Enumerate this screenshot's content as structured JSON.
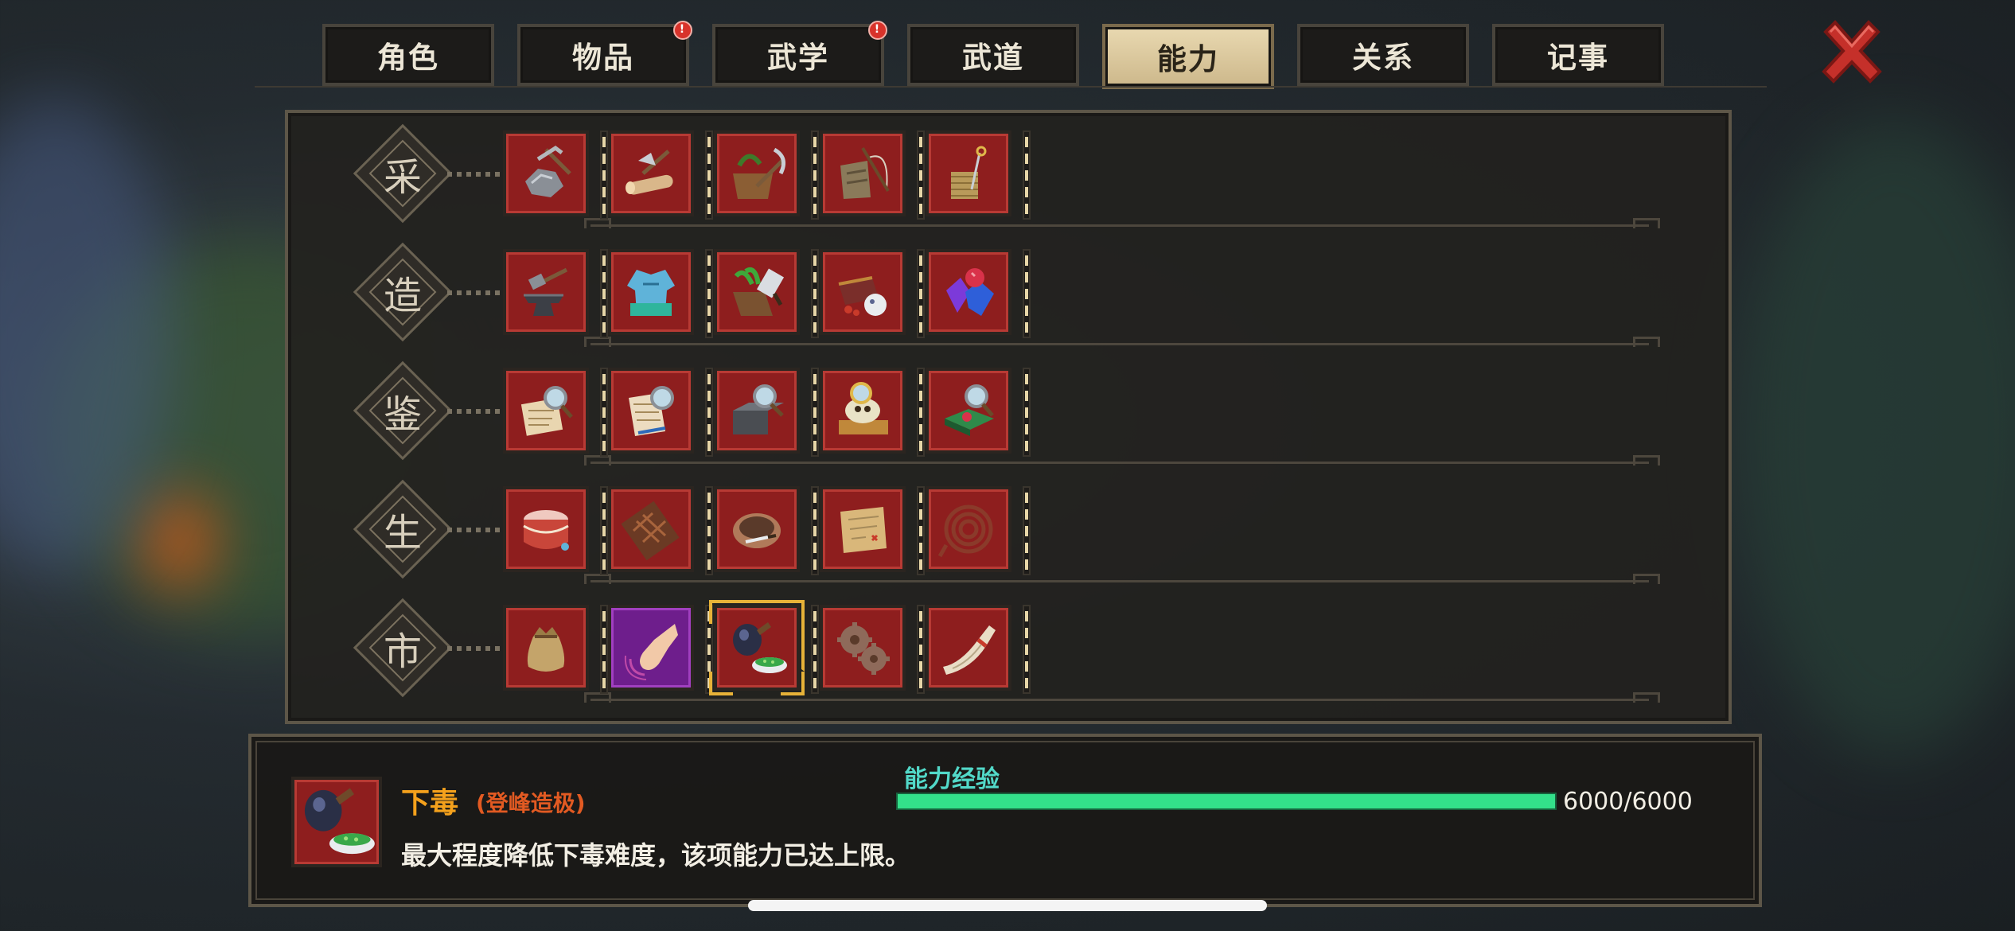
{
  "tabs": [
    {
      "label": "角色",
      "badge": false,
      "active": false
    },
    {
      "label": "物品",
      "badge": true,
      "active": false
    },
    {
      "label": "武学",
      "badge": true,
      "active": false
    },
    {
      "label": "武道",
      "badge": false,
      "active": false
    },
    {
      "label": "能力",
      "badge": false,
      "active": true
    },
    {
      "label": "关系",
      "badge": false,
      "active": false
    },
    {
      "label": "记事",
      "badge": false,
      "active": false
    }
  ],
  "badge_text": "!",
  "categories": [
    {
      "label": "采",
      "skills": [
        {
          "icon": "ore-pickaxe-icon",
          "tier": "red"
        },
        {
          "icon": "log-axe-icon",
          "tier": "red"
        },
        {
          "icon": "herb-basket-sickle-icon",
          "tier": "red"
        },
        {
          "icon": "fishing-creel-icon",
          "tier": "red"
        },
        {
          "icon": "silk-spool-icon",
          "tier": "red"
        }
      ]
    },
    {
      "label": "造",
      "skills": [
        {
          "icon": "anvil-hammer-icon",
          "tier": "red"
        },
        {
          "icon": "tailored-clothing-icon",
          "tier": "red"
        },
        {
          "icon": "herb-cleaver-icon",
          "tier": "red"
        },
        {
          "icon": "cooking-chest-icon",
          "tier": "red"
        },
        {
          "icon": "gemstones-icon",
          "tier": "red"
        }
      ]
    },
    {
      "label": "鉴",
      "skills": [
        {
          "icon": "appraise-scroll-icon",
          "tier": "red"
        },
        {
          "icon": "appraise-book-icon",
          "tier": "red"
        },
        {
          "icon": "appraise-iron-icon",
          "tier": "red"
        },
        {
          "icon": "appraise-antique-icon",
          "tier": "red"
        },
        {
          "icon": "appraise-jade-icon",
          "tier": "red"
        }
      ]
    },
    {
      "label": "生",
      "skills": [
        {
          "icon": "drum-icon",
          "tier": "red"
        },
        {
          "icon": "chocolate-bar-icon",
          "tier": "red"
        },
        {
          "icon": "bowl-knife-icon",
          "tier": "red"
        },
        {
          "icon": "treasure-map-icon",
          "tier": "red"
        },
        {
          "icon": "coiled-rope-icon",
          "tier": "red"
        }
      ]
    },
    {
      "label": "市",
      "skills": [
        {
          "icon": "money-bag-icon",
          "tier": "red"
        },
        {
          "icon": "pointing-finger-icon",
          "tier": "purple"
        },
        {
          "icon": "poison-pouring-icon",
          "tier": "red",
          "selected": true
        },
        {
          "icon": "gears-icon",
          "tier": "red"
        },
        {
          "icon": "horn-icon",
          "tier": "red"
        }
      ]
    }
  ],
  "selected_skill": {
    "name": "下毒",
    "grade": "(登峰造极)",
    "description": "最大程度降低下毒难度，该项能力已达上限。",
    "exp_label": "能力经验",
    "exp_current": 6000,
    "exp_max": 6000,
    "exp_text": "6000/6000"
  },
  "colors": {
    "accent_gold": "#e7b238",
    "skill_name": "#f4a11c",
    "grade": "#e25a22",
    "exp_label": "#52d9c9",
    "exp_bar": "#33e08a",
    "tier_red": "#8e1e1e",
    "tier_purple": "#6e1e8c"
  }
}
